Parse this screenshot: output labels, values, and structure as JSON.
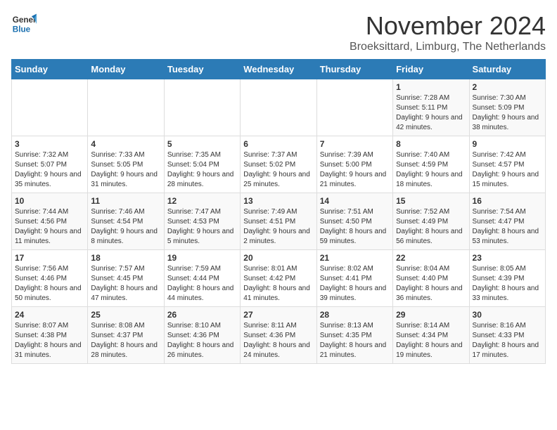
{
  "logo": {
    "line1": "General",
    "line2": "Blue"
  },
  "title": "November 2024",
  "location": "Broeksittard, Limburg, The Netherlands",
  "days_of_week": [
    "Sunday",
    "Monday",
    "Tuesday",
    "Wednesday",
    "Thursday",
    "Friday",
    "Saturday"
  ],
  "weeks": [
    [
      {
        "day": "",
        "info": ""
      },
      {
        "day": "",
        "info": ""
      },
      {
        "day": "",
        "info": ""
      },
      {
        "day": "",
        "info": ""
      },
      {
        "day": "",
        "info": ""
      },
      {
        "day": "1",
        "info": "Sunrise: 7:28 AM\nSunset: 5:11 PM\nDaylight: 9 hours and 42 minutes."
      },
      {
        "day": "2",
        "info": "Sunrise: 7:30 AM\nSunset: 5:09 PM\nDaylight: 9 hours and 38 minutes."
      }
    ],
    [
      {
        "day": "3",
        "info": "Sunrise: 7:32 AM\nSunset: 5:07 PM\nDaylight: 9 hours and 35 minutes."
      },
      {
        "day": "4",
        "info": "Sunrise: 7:33 AM\nSunset: 5:05 PM\nDaylight: 9 hours and 31 minutes."
      },
      {
        "day": "5",
        "info": "Sunrise: 7:35 AM\nSunset: 5:04 PM\nDaylight: 9 hours and 28 minutes."
      },
      {
        "day": "6",
        "info": "Sunrise: 7:37 AM\nSunset: 5:02 PM\nDaylight: 9 hours and 25 minutes."
      },
      {
        "day": "7",
        "info": "Sunrise: 7:39 AM\nSunset: 5:00 PM\nDaylight: 9 hours and 21 minutes."
      },
      {
        "day": "8",
        "info": "Sunrise: 7:40 AM\nSunset: 4:59 PM\nDaylight: 9 hours and 18 minutes."
      },
      {
        "day": "9",
        "info": "Sunrise: 7:42 AM\nSunset: 4:57 PM\nDaylight: 9 hours and 15 minutes."
      }
    ],
    [
      {
        "day": "10",
        "info": "Sunrise: 7:44 AM\nSunset: 4:56 PM\nDaylight: 9 hours and 11 minutes."
      },
      {
        "day": "11",
        "info": "Sunrise: 7:46 AM\nSunset: 4:54 PM\nDaylight: 9 hours and 8 minutes."
      },
      {
        "day": "12",
        "info": "Sunrise: 7:47 AM\nSunset: 4:53 PM\nDaylight: 9 hours and 5 minutes."
      },
      {
        "day": "13",
        "info": "Sunrise: 7:49 AM\nSunset: 4:51 PM\nDaylight: 9 hours and 2 minutes."
      },
      {
        "day": "14",
        "info": "Sunrise: 7:51 AM\nSunset: 4:50 PM\nDaylight: 8 hours and 59 minutes."
      },
      {
        "day": "15",
        "info": "Sunrise: 7:52 AM\nSunset: 4:49 PM\nDaylight: 8 hours and 56 minutes."
      },
      {
        "day": "16",
        "info": "Sunrise: 7:54 AM\nSunset: 4:47 PM\nDaylight: 8 hours and 53 minutes."
      }
    ],
    [
      {
        "day": "17",
        "info": "Sunrise: 7:56 AM\nSunset: 4:46 PM\nDaylight: 8 hours and 50 minutes."
      },
      {
        "day": "18",
        "info": "Sunrise: 7:57 AM\nSunset: 4:45 PM\nDaylight: 8 hours and 47 minutes."
      },
      {
        "day": "19",
        "info": "Sunrise: 7:59 AM\nSunset: 4:44 PM\nDaylight: 8 hours and 44 minutes."
      },
      {
        "day": "20",
        "info": "Sunrise: 8:01 AM\nSunset: 4:42 PM\nDaylight: 8 hours and 41 minutes."
      },
      {
        "day": "21",
        "info": "Sunrise: 8:02 AM\nSunset: 4:41 PM\nDaylight: 8 hours and 39 minutes."
      },
      {
        "day": "22",
        "info": "Sunrise: 8:04 AM\nSunset: 4:40 PM\nDaylight: 8 hours and 36 minutes."
      },
      {
        "day": "23",
        "info": "Sunrise: 8:05 AM\nSunset: 4:39 PM\nDaylight: 8 hours and 33 minutes."
      }
    ],
    [
      {
        "day": "24",
        "info": "Sunrise: 8:07 AM\nSunset: 4:38 PM\nDaylight: 8 hours and 31 minutes."
      },
      {
        "day": "25",
        "info": "Sunrise: 8:08 AM\nSunset: 4:37 PM\nDaylight: 8 hours and 28 minutes."
      },
      {
        "day": "26",
        "info": "Sunrise: 8:10 AM\nSunset: 4:36 PM\nDaylight: 8 hours and 26 minutes."
      },
      {
        "day": "27",
        "info": "Sunrise: 8:11 AM\nSunset: 4:36 PM\nDaylight: 8 hours and 24 minutes."
      },
      {
        "day": "28",
        "info": "Sunrise: 8:13 AM\nSunset: 4:35 PM\nDaylight: 8 hours and 21 minutes."
      },
      {
        "day": "29",
        "info": "Sunrise: 8:14 AM\nSunset: 4:34 PM\nDaylight: 8 hours and 19 minutes."
      },
      {
        "day": "30",
        "info": "Sunrise: 8:16 AM\nSunset: 4:33 PM\nDaylight: 8 hours and 17 minutes."
      }
    ]
  ]
}
